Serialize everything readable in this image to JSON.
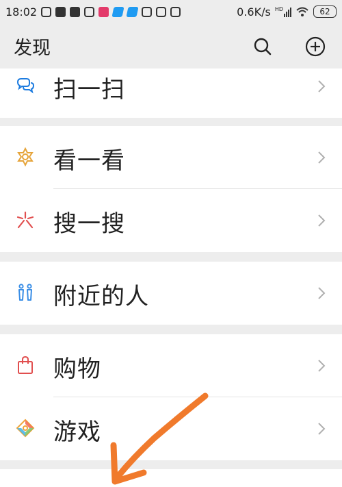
{
  "status_bar": {
    "time": "18:02",
    "network_speed": "0.6K/s",
    "signal_label": "HD",
    "battery_level": "62",
    "icons": [
      "charging-icon",
      "message-icon",
      "message-icon",
      "mi-icon",
      "app-icon",
      "cloud-icon",
      "cloud-icon",
      "link-icon",
      "app-icon",
      "bird-icon",
      "signal-icon",
      "wifi-icon",
      "battery-icon"
    ]
  },
  "header": {
    "title": "发现",
    "search_icon": "search-icon",
    "add_icon": "add-circle-icon"
  },
  "menu": {
    "scan": {
      "label": "扫一扫",
      "icon": "scan-icon",
      "color": "#1d7ce0"
    },
    "look": {
      "label": "看一看",
      "icon": "look-icon",
      "color": "#e6a43a"
    },
    "search": {
      "label": "搜一搜",
      "icon": "search-star-icon",
      "color": "#e14f4f"
    },
    "nearby": {
      "label": "附近的人",
      "icon": "people-nearby-icon",
      "color": "#3a8ee6"
    },
    "shopping": {
      "label": "购物",
      "icon": "shopping-bag-icon",
      "color": "#e14f4f"
    },
    "games": {
      "label": "游戏",
      "icon": "game-icon",
      "color": "#f0a53a"
    }
  },
  "annotation": {
    "arrow_color": "#f07a2c",
    "icon": "orange-arrow-annotation"
  }
}
